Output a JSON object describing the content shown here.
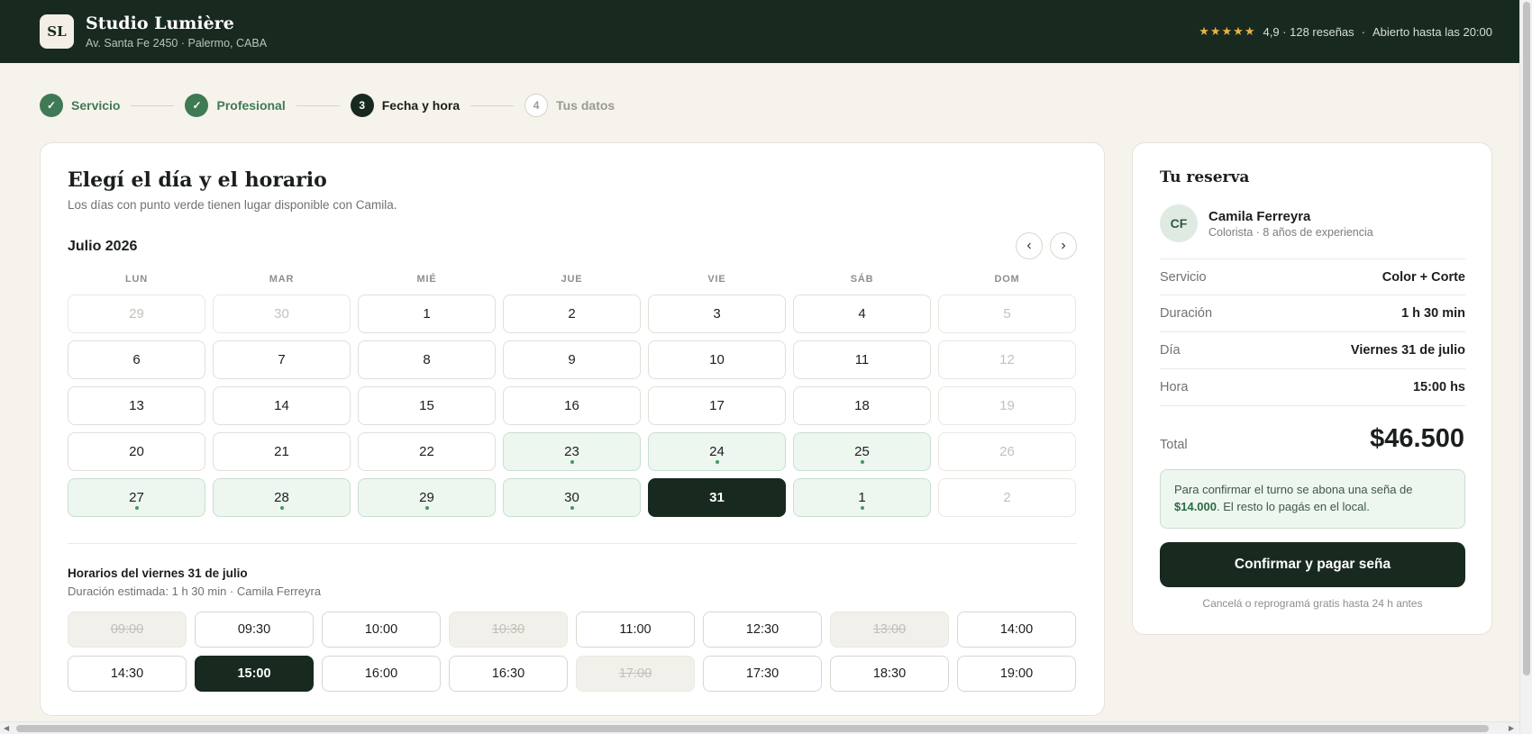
{
  "header": {
    "logo_initials": "SL",
    "studio_name": "Studio Lumière",
    "address": "Av. Santa Fe 2450 · Palermo, CABA",
    "stars": "★★★★★",
    "rating_text": "4,9 · 128 reseñas",
    "separator": "·",
    "hours_text": "Abierto hasta las 20:00"
  },
  "stepper": [
    {
      "num": "✓",
      "label": "Servicio",
      "state": "done"
    },
    {
      "num": "✓",
      "label": "Profesional",
      "state": "done"
    },
    {
      "num": "3",
      "label": "Fecha y hora",
      "state": "active"
    },
    {
      "num": "4",
      "label": "Tus datos",
      "state": "todo"
    }
  ],
  "calendar": {
    "title": "Elegí el día y el horario",
    "subtitle": "Los días con punto verde tienen lugar disponible con Camila.",
    "month": "Julio 2026",
    "prev_icon": "‹",
    "next_icon": "›",
    "weekdays": [
      "LUN",
      "MAR",
      "MIÉ",
      "JUE",
      "VIE",
      "SÁB",
      "DOM"
    ],
    "days": [
      {
        "d": "29",
        "state": "muted"
      },
      {
        "d": "30",
        "state": "muted"
      },
      {
        "d": "1",
        "state": "normal"
      },
      {
        "d": "2",
        "state": "normal"
      },
      {
        "d": "3",
        "state": "normal"
      },
      {
        "d": "4",
        "state": "normal"
      },
      {
        "d": "5",
        "state": "muted"
      },
      {
        "d": "6",
        "state": "normal"
      },
      {
        "d": "7",
        "state": "normal"
      },
      {
        "d": "8",
        "state": "normal"
      },
      {
        "d": "9",
        "state": "normal"
      },
      {
        "d": "10",
        "state": "normal"
      },
      {
        "d": "11",
        "state": "normal"
      },
      {
        "d": "12",
        "state": "muted"
      },
      {
        "d": "13",
        "state": "normal"
      },
      {
        "d": "14",
        "state": "normal"
      },
      {
        "d": "15",
        "state": "normal"
      },
      {
        "d": "16",
        "state": "normal"
      },
      {
        "d": "17",
        "state": "normal"
      },
      {
        "d": "18",
        "state": "normal"
      },
      {
        "d": "19",
        "state": "muted"
      },
      {
        "d": "20",
        "state": "normal"
      },
      {
        "d": "21",
        "state": "normal"
      },
      {
        "d": "22",
        "state": "normal"
      },
      {
        "d": "23",
        "state": "avail"
      },
      {
        "d": "24",
        "state": "avail"
      },
      {
        "d": "25",
        "state": "avail"
      },
      {
        "d": "26",
        "state": "muted"
      },
      {
        "d": "27",
        "state": "avail"
      },
      {
        "d": "28",
        "state": "avail"
      },
      {
        "d": "29",
        "state": "avail"
      },
      {
        "d": "30",
        "state": "avail"
      },
      {
        "d": "31",
        "state": "selected"
      },
      {
        "d": "1",
        "state": "avail"
      },
      {
        "d": "2",
        "state": "muted"
      }
    ]
  },
  "times": {
    "title": "Horarios del viernes 31 de julio",
    "subtitle": "Duración estimada: 1 h 30 min · Camila Ferreyra",
    "slots": [
      {
        "t": "09:00",
        "state": "disabled"
      },
      {
        "t": "09:30",
        "state": "normal"
      },
      {
        "t": "10:00",
        "state": "normal"
      },
      {
        "t": "10:30",
        "state": "disabled"
      },
      {
        "t": "11:00",
        "state": "normal"
      },
      {
        "t": "12:30",
        "state": "normal"
      },
      {
        "t": "13:00",
        "state": "disabled"
      },
      {
        "t": "14:00",
        "state": "normal"
      },
      {
        "t": "14:30",
        "state": "normal"
      },
      {
        "t": "15:00",
        "state": "selected"
      },
      {
        "t": "16:00",
        "state": "normal"
      },
      {
        "t": "16:30",
        "state": "normal"
      },
      {
        "t": "17:00",
        "state": "disabled"
      },
      {
        "t": "17:30",
        "state": "normal"
      },
      {
        "t": "18:30",
        "state": "normal"
      },
      {
        "t": "19:00",
        "state": "normal"
      }
    ]
  },
  "summary": {
    "title": "Tu reserva",
    "avatar_initials": "CF",
    "pro_name": "Camila Ferreyra",
    "pro_role": "Colorista · 8 años de experiencia",
    "rows": [
      {
        "label": "Servicio",
        "value": "Color + Corte"
      },
      {
        "label": "Duración",
        "value": "1 h 30 min"
      },
      {
        "label": "Día",
        "value": "Viernes 31 de julio"
      },
      {
        "label": "Hora",
        "value": "15:00 hs"
      }
    ],
    "total_label": "Total",
    "total_value": "$46.500",
    "note_before": "Para confirmar el turno se abona una seña de ",
    "note_amount": "$14.000",
    "note_after": ". El resto lo pagás en el local.",
    "cta_label": "Confirmar y pagar seña",
    "footer": "Cancelá o reprogramá gratis hasta 24 h antes"
  },
  "colors": {
    "brand_dark": "#18291f",
    "accent_green": "#3f7a55",
    "available_bg": "#eef6f0",
    "star": "#e8b24a",
    "page_bg": "#f6f3ec"
  }
}
